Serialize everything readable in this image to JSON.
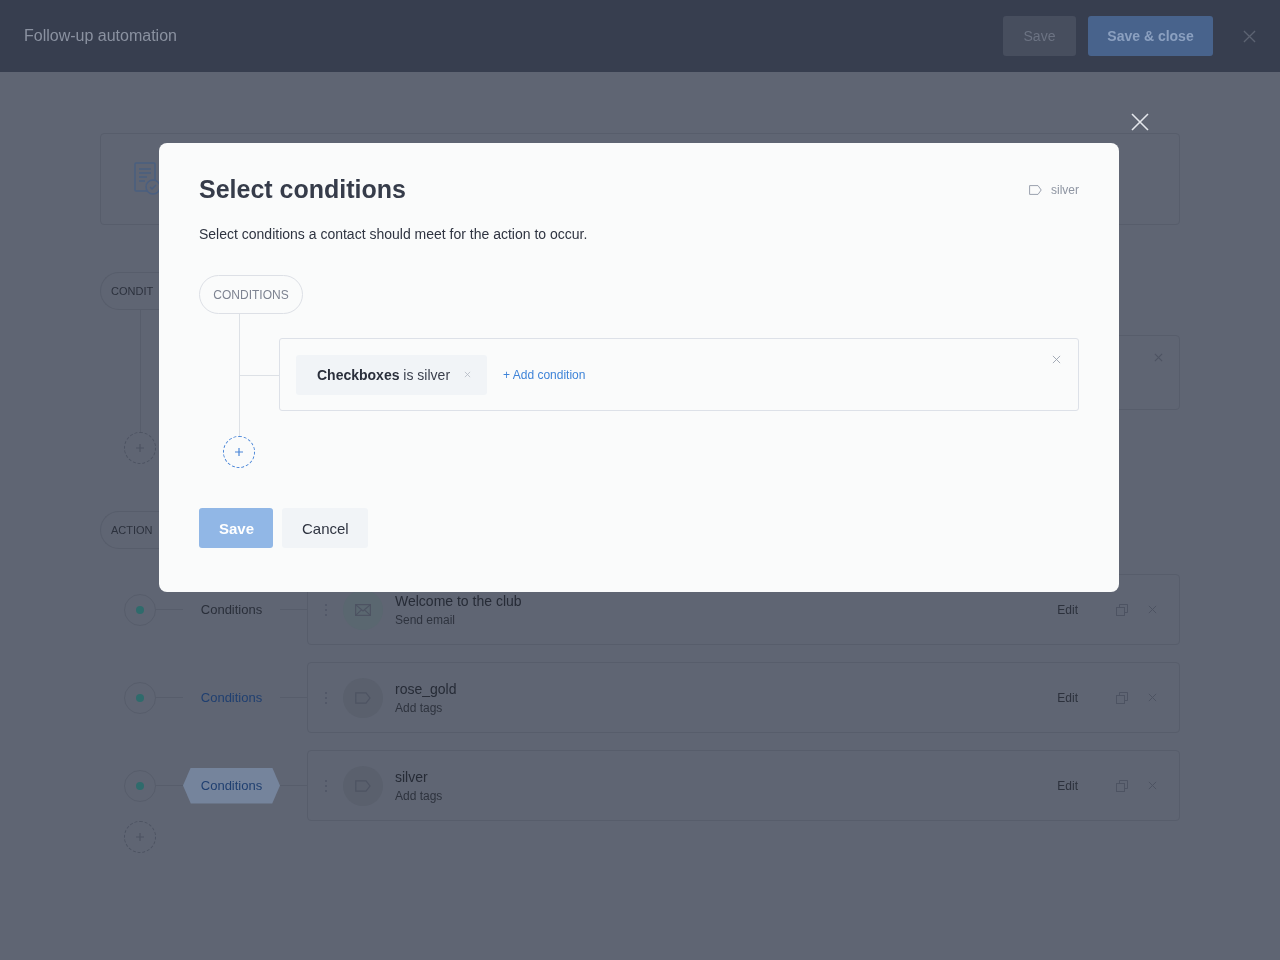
{
  "header": {
    "title": "Follow-up automation",
    "buttons": [
      {
        "label": "Save",
        "kind": "secondary"
      },
      {
        "label": "Save & close",
        "kind": "primary"
      }
    ]
  },
  "background": {
    "conditions_pill": "CONDIT",
    "actions_pill": "ACTION",
    "actions": [
      {
        "title": "Welcome to the club",
        "subtitle": "Send email",
        "kind": "email",
        "conditions": "Conditions",
        "conditions_active": false,
        "selected": false,
        "edit": "Edit"
      },
      {
        "title": "rose_gold",
        "subtitle": "Add tags",
        "kind": "tag",
        "conditions": "Conditions",
        "conditions_active": true,
        "selected": false,
        "edit": "Edit"
      },
      {
        "title": "silver",
        "subtitle": "Add tags",
        "kind": "tag",
        "conditions": "Conditions",
        "conditions_active": true,
        "selected": true,
        "edit": "Edit"
      }
    ]
  },
  "dialog": {
    "title": "Select conditions",
    "tag": "silver",
    "description": "Select conditions a contact should meet for the action to occur.",
    "conditions_pill": "CONDITIONS",
    "conditions": [
      {
        "text": "**Checkboxes** is silver"
      }
    ],
    "add_condition": "+ Add condition",
    "buttons": [
      {
        "label": "Save",
        "kind": "primary",
        "disabled": true
      },
      {
        "label": "Cancel",
        "kind": "secondary",
        "disabled": false
      }
    ]
  }
}
